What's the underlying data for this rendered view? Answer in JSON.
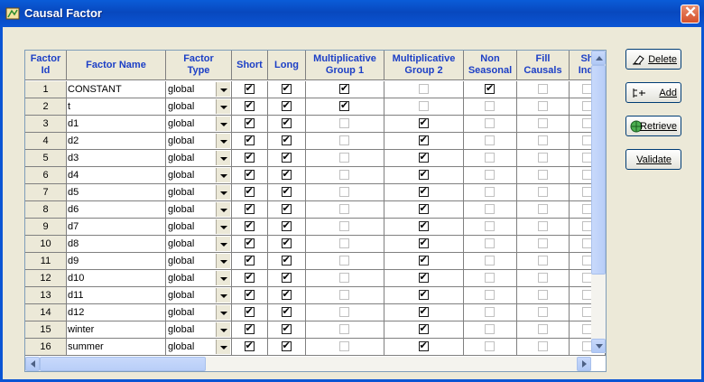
{
  "window": {
    "title": "Causal Factor"
  },
  "columns": [
    "Factor\nId",
    "Factor Name",
    "Factor\nType",
    "Short",
    "Long",
    "Multiplicative\nGroup 1",
    "Multiplicative\nGroup 2",
    "Non\nSeasonal",
    "Fill\nCausals",
    "Sh\nIndi"
  ],
  "rows": [
    {
      "id": "1",
      "name": "CONSTANT",
      "type": "global",
      "short": true,
      "long": true,
      "mg1": true,
      "mg2": false,
      "ns": true
    },
    {
      "id": "2",
      "name": "t",
      "type": "global",
      "short": true,
      "long": true,
      "mg1": true,
      "mg2": false,
      "ns": false
    },
    {
      "id": "3",
      "name": "d1",
      "type": "global",
      "short": true,
      "long": true,
      "mg1": false,
      "mg2": true,
      "ns": false
    },
    {
      "id": "4",
      "name": "d2",
      "type": "global",
      "short": true,
      "long": true,
      "mg1": false,
      "mg2": true,
      "ns": false
    },
    {
      "id": "5",
      "name": "d3",
      "type": "global",
      "short": true,
      "long": true,
      "mg1": false,
      "mg2": true,
      "ns": false
    },
    {
      "id": "6",
      "name": "d4",
      "type": "global",
      "short": true,
      "long": true,
      "mg1": false,
      "mg2": true,
      "ns": false
    },
    {
      "id": "7",
      "name": "d5",
      "type": "global",
      "short": true,
      "long": true,
      "mg1": false,
      "mg2": true,
      "ns": false
    },
    {
      "id": "8",
      "name": "d6",
      "type": "global",
      "short": true,
      "long": true,
      "mg1": false,
      "mg2": true,
      "ns": false
    },
    {
      "id": "9",
      "name": "d7",
      "type": "global",
      "short": true,
      "long": true,
      "mg1": false,
      "mg2": true,
      "ns": false
    },
    {
      "id": "10",
      "name": "d8",
      "type": "global",
      "short": true,
      "long": true,
      "mg1": false,
      "mg2": true,
      "ns": false
    },
    {
      "id": "11",
      "name": "d9",
      "type": "global",
      "short": true,
      "long": true,
      "mg1": false,
      "mg2": true,
      "ns": false
    },
    {
      "id": "12",
      "name": "d10",
      "type": "global",
      "short": true,
      "long": true,
      "mg1": false,
      "mg2": true,
      "ns": false
    },
    {
      "id": "13",
      "name": "d11",
      "type": "global",
      "short": true,
      "long": true,
      "mg1": false,
      "mg2": true,
      "ns": false
    },
    {
      "id": "14",
      "name": "d12",
      "type": "global",
      "short": true,
      "long": true,
      "mg1": false,
      "mg2": true,
      "ns": false
    },
    {
      "id": "15",
      "name": "winter",
      "type": "global",
      "short": true,
      "long": true,
      "mg1": false,
      "mg2": true,
      "ns": false
    },
    {
      "id": "16",
      "name": "summer",
      "type": "global",
      "short": true,
      "long": true,
      "mg1": false,
      "mg2": true,
      "ns": false
    }
  ],
  "buttons": {
    "delete": "Delete",
    "add": "Add",
    "retrieve": "Retrieve",
    "validate": "Validate"
  },
  "check_glyph": "✔",
  "colors": {
    "header_text": "#1C3FC6",
    "titlebar": "#0A5CD8"
  },
  "icons": {
    "app": "app-window-icon",
    "close": "close-icon",
    "delete": "eraser-icon",
    "add": "add-row-icon",
    "retrieve": "globe-refresh-icon"
  }
}
